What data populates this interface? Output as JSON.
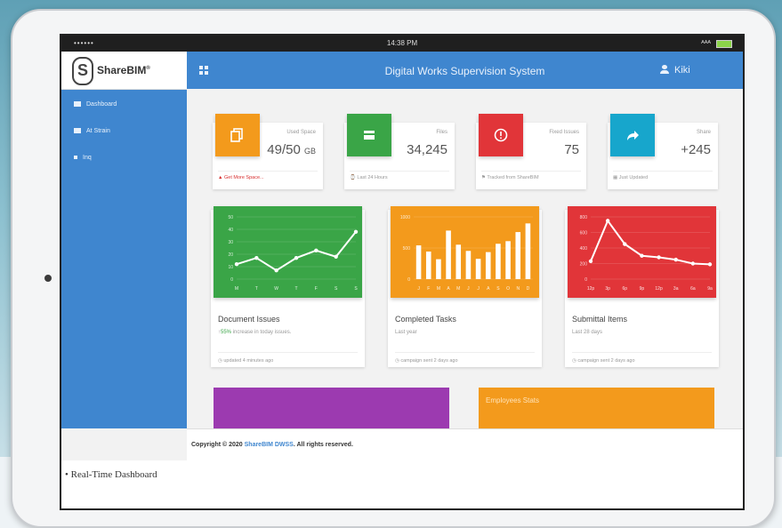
{
  "status_bar": {
    "carrier": "••••••",
    "time": "14:38 PM",
    "signal": "ᴬᴬᴬ"
  },
  "app": {
    "logo_text": "ShareBIM",
    "logo_mark": "S",
    "title": "Digital Works Supervision System",
    "user": "Kiki"
  },
  "sidebar": {
    "items": [
      {
        "label": "Dashboard"
      },
      {
        "label": "At Strain"
      },
      {
        "label": "Inq"
      }
    ]
  },
  "stats": [
    {
      "label": "Used Space",
      "value": "49/50",
      "unit": "GB",
      "footer": "Get More Space...",
      "color": "#f39a1c",
      "icon": "copy-icon"
    },
    {
      "label": "Files",
      "value": "34,245",
      "footer": "Last 24 Hours",
      "color": "#3aa547",
      "icon": "store-icon"
    },
    {
      "label": "Fixed Issues",
      "value": "75",
      "footer": "Tracked from ShareBIM",
      "color": "#e13539",
      "icon": "info-icon"
    },
    {
      "label": "Share",
      "value": "+245",
      "footer": "Just Updated",
      "color": "#17a6cc",
      "icon": "share-icon"
    }
  ],
  "charts": [
    {
      "title": "Document Issues",
      "subtitle_highlight": "55%",
      "subtitle": "increase in today issues.",
      "footer": "updated 4 minutes ago",
      "color": "#3aa547",
      "icon": "clock-icon"
    },
    {
      "title": "Completed Tasks",
      "subtitle": "Last year",
      "footer": "campaign sent 2 days ago",
      "color": "#f39a1c",
      "icon": "clock-icon"
    },
    {
      "title": "Submittal Items",
      "subtitle": "Last 28 days",
      "footer": "campaign sent 2 days ago",
      "color": "#e13539",
      "icon": "clock-icon"
    }
  ],
  "chart_data": [
    {
      "type": "line",
      "x": [
        "M",
        "T",
        "W",
        "T",
        "F",
        "S",
        "S"
      ],
      "values": [
        12,
        17,
        7,
        17,
        23,
        18,
        38
      ],
      "ylim": [
        0,
        50
      ],
      "yticks": [
        0,
        10,
        20,
        30,
        40,
        50
      ],
      "grid": true
    },
    {
      "type": "bar",
      "categories": [
        "J",
        "F",
        "M",
        "A",
        "M",
        "J",
        "J",
        "A",
        "S",
        "O",
        "N",
        "D"
      ],
      "values": [
        542,
        443,
        320,
        780,
        553,
        453,
        326,
        434,
        568,
        610,
        756,
        895
      ],
      "ylim": [
        0,
        1000
      ],
      "grid": true
    },
    {
      "type": "line",
      "x": [
        "12p",
        "3p",
        "6p",
        "9p",
        "12p",
        "3a",
        "6a",
        "9a"
      ],
      "values": [
        230,
        750,
        450,
        300,
        280,
        250,
        200,
        190
      ],
      "ylim": [
        0,
        800
      ],
      "yticks": [
        0,
        200,
        400,
        600,
        800
      ],
      "grid": true
    }
  ],
  "bottom_cards": [
    {
      "color": "#9c3ab0",
      "title": ""
    },
    {
      "color": "#f39a1c",
      "title": "Employees Stats"
    }
  ],
  "footer": {
    "prefix": "Copyright © 2020 ",
    "brand": "ShareBIM DWSS",
    "suffix": ". All rights reserved."
  },
  "caption": "• Real-Time Dashboard"
}
